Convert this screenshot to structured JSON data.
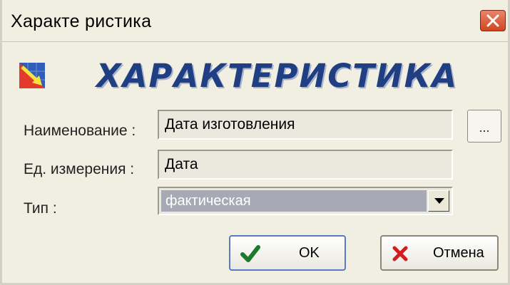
{
  "window": {
    "title": "Характе ристика",
    "close_icon": "close-icon"
  },
  "banner": {
    "icon": "chart-arrow-icon",
    "title": "ХАРАКТЕРИСТИКА"
  },
  "form": {
    "name_label": "Наименование :",
    "name_value": "Дата изготовления",
    "browse_label": "...",
    "unit_label": "Ед. измерения :",
    "unit_value": "Дата",
    "type_label": "Тип :",
    "type_value": "фактическая"
  },
  "buttons": {
    "ok_label": "OK",
    "cancel_label": "Отмена"
  },
  "colors": {
    "banner_text": "#1f3f82",
    "close_button": "#d2451f",
    "ok_check": "#1d7a2a",
    "cancel_x": "#d11d1d"
  }
}
